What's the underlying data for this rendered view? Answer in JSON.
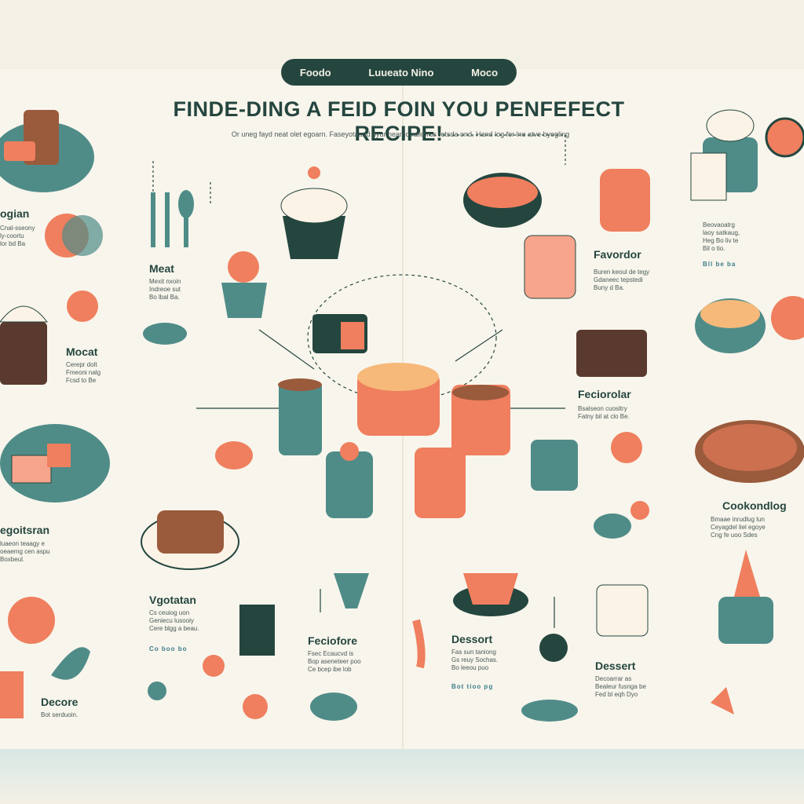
{
  "nav": {
    "items": [
      "Foodo",
      "Luueato Nino",
      "Moco"
    ]
  },
  "title": "FINDE-DING A FEID FOIN YOU PENFEFECT  RECIPE!",
  "subtitle": "Or uneg fayd neat olet egoarn. Faseyotaand pyur neamo ralid rus retsda ond. Hand log for lne atve byogling",
  "colors": {
    "teal": "#4f8c88",
    "coral": "#ef7f5e",
    "cream": "#f8f5ec",
    "dark": "#24463f"
  },
  "left_panel": {
    "sections": [
      {
        "label": "ogian",
        "desc": [
          "Cnal-sseony",
          "ly-coortu",
          "lor bd Ba"
        ]
      },
      {
        "label": "Mocat",
        "desc": [
          "Cerepr dolt",
          "Fmeoni nalg",
          "Fcsd to Be"
        ]
      },
      {
        "label": "egoitsran",
        "desc": [
          "luaeon teaagy e",
          "oeaemg cen aspu",
          "Boxbeul."
        ]
      },
      {
        "label": "Decore",
        "desc": [
          "Bot serduoin."
        ]
      }
    ]
  },
  "middle_panel": {
    "meat": {
      "label": "Meat",
      "desc": [
        "Mexit nxoin",
        "Indreoe sut",
        "Bo lbal Ba."
      ]
    },
    "favorites": {
      "label": "Favordor",
      "desc": [
        "Buren keoul de tegy",
        "Gdaneec tepstedi",
        "Buny d Ba."
      ]
    },
    "preferences": {
      "label": "Feciorolar",
      "desc": [
        "Bsalseon cuosltry",
        "Fatny bil at clo Be."
      ]
    },
    "vegetarian": {
      "label": "Vgotatan",
      "desc": [
        "Cs ceuiog uon",
        "Geniecu lusooiy",
        "Cere blgg a beau."
      ],
      "tag": "Co boo bo"
    },
    "preference2": {
      "label": "Feciofore",
      "desc": [
        "Fsec Ecaucvd is",
        "Bop aseneteer poo",
        "Ce bcep ibe lob"
      ]
    },
    "dessert": {
      "label": "Dessort",
      "desc": [
        "Fas sun taniong",
        "Gs reuy Sochas.",
        "Bo leeou puo"
      ],
      "tag": "Bot tioo pg"
    }
  },
  "right_panel": {
    "sections": [
      {
        "label": "",
        "desc": [
          "Beovaoatrg",
          "laoy satkaug,",
          "Heg Bo liv te",
          "Bil o tio."
        ],
        "tag": "Bll be ba"
      },
      {
        "label": "Cookondlog",
        "desc": [
          "Bmaae inrudlug lun",
          "Ceyagdel liel egoye",
          "Cng fe uoo Sdes"
        ]
      },
      {
        "label": "Dessert",
        "desc": [
          "Decoarrar as",
          "Bealeur fusnga be",
          "Fed bl eqh Dyo"
        ]
      }
    ]
  }
}
